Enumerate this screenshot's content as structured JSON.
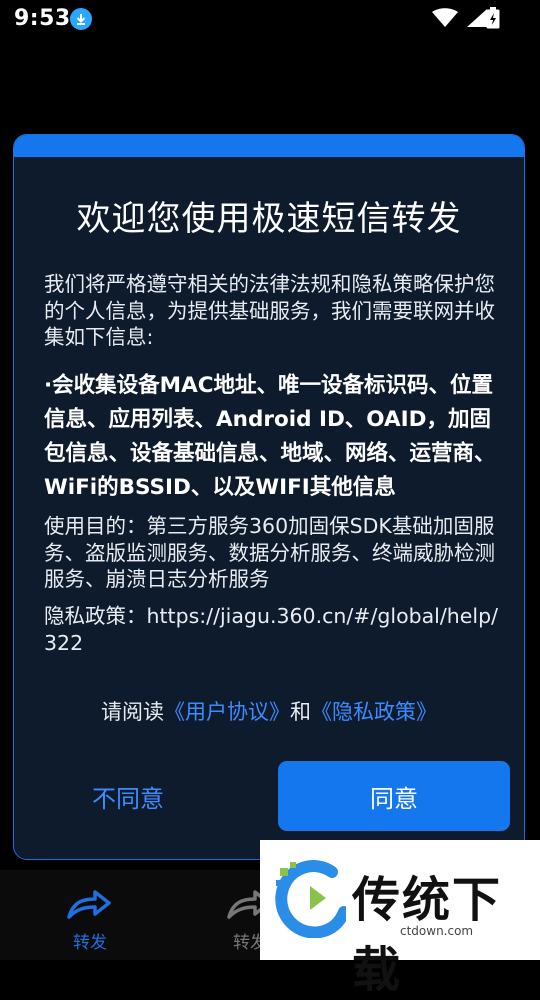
{
  "status_bar": {
    "time": "9:53"
  },
  "bottom_nav": {
    "items": [
      {
        "label": "转发",
        "icon": "forward-icon",
        "color": "#1f6fe0"
      },
      {
        "label": "转发",
        "icon": "forward-icon"
      }
    ]
  },
  "dialog": {
    "title": "欢迎您使用极速短信转发",
    "para1": "我们将严格遵守相关的法律法规和隐私策略保护您的个人信息，为提供基础服务，我们需要联网并收集如下信息:",
    "para2": "·会收集设备MAC地址、唯一设备标识码、位置信息、应用列表、Android ID、OAID，加固包信息、设备基础信息、地域、网络、运营商、WiFi的BSSID、以及WIFI其他信息",
    "para3": "使用目的：第三方服务360加固保SDK基础加固服务、盗版监测服务、数据分析服务、终端威胁检测服务、崩溃日志分析服务",
    "para4": "隐私政策：https://jiagu.360.cn/#/global/help/322",
    "read_prefix": "请阅读",
    "user_agreement": "《用户协议》",
    "and": "和",
    "privacy_policy": "《隐私政策》",
    "disagree_label": "不同意",
    "agree_label": "同意",
    "accent_color": "#1477ee",
    "link_color": "#3e8bff"
  },
  "watermark": {
    "text": "传统下载",
    "url": "ctdown.com"
  }
}
